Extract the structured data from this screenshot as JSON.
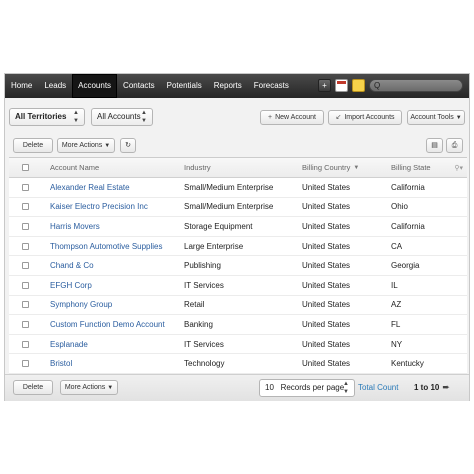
{
  "nav": {
    "tabs": [
      {
        "label": "Home",
        "active": false
      },
      {
        "label": "Leads",
        "active": false
      },
      {
        "label": "Accounts",
        "active": true
      },
      {
        "label": "Contacts",
        "active": false
      },
      {
        "label": "Potentials",
        "active": false
      },
      {
        "label": "Reports",
        "active": false
      },
      {
        "label": "Forecasts",
        "active": false
      }
    ],
    "add_icon": "plus-icon",
    "calendar_icon": "calendar-icon",
    "notes_icon": "sticky-note-icon",
    "search_icon": "search-icon",
    "search_glyph": "Q"
  },
  "filters": {
    "territory": "All Territories",
    "view": "All Accounts"
  },
  "toolbar": {
    "new_account": "New Account",
    "import_accounts": "Import Accounts",
    "account_tools": "Account Tools",
    "delete": "Delete",
    "more_actions": "More Actions"
  },
  "table": {
    "headers": {
      "name": "Account Name",
      "industry": "Industry",
      "country": "Billing Country",
      "state": "Billing State"
    },
    "rows": [
      {
        "name": "Alexander Real Estate",
        "industry": "Small/Medium Enterprise",
        "country": "United States",
        "state": "California"
      },
      {
        "name": "Kaiser Electro Precision Inc",
        "industry": "Small/Medium Enterprise",
        "country": "United States",
        "state": "Ohio"
      },
      {
        "name": "Harris Movers",
        "industry": "Storage Equipment",
        "country": "United States",
        "state": "California"
      },
      {
        "name": "Thompson Automotive Supplies",
        "industry": "Large Enterprise",
        "country": "United States",
        "state": "CA"
      },
      {
        "name": "Chand & Co",
        "industry": "Publishing",
        "country": "United States",
        "state": "Georgia"
      },
      {
        "name": "EFGH Corp",
        "industry": "IT Services",
        "country": "United States",
        "state": "IL"
      },
      {
        "name": "Symphony Group",
        "industry": "Retail",
        "country": "United States",
        "state": "AZ"
      },
      {
        "name": "Custom Function Demo Account",
        "industry": "Banking",
        "country": "United States",
        "state": "FL"
      },
      {
        "name": "Esplanade",
        "industry": "IT Services",
        "country": "United States",
        "state": "NY"
      },
      {
        "name": "Bristol",
        "industry": "Technology",
        "country": "United States",
        "state": "Kentucky"
      }
    ]
  },
  "footer": {
    "records_per_page_value": "10",
    "records_per_page_label": "Records per page",
    "total_count": "Total Count",
    "page_range": "1 to 10"
  },
  "colors": {
    "link": "#2a5d9f",
    "nav_bg": "#262626",
    "nav_active": "#151515"
  }
}
